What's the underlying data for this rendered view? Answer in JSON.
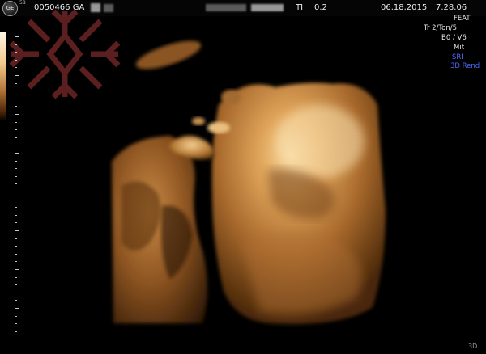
{
  "header": {
    "logo_text": "GE",
    "probe_index": "58",
    "patient_id": "0050466 GA",
    "ti_label": "TI",
    "ti_value": "0.2",
    "date": "06.18.2015",
    "time": "7.28.06"
  },
  "settings": [
    "FEAT",
    "Tr 2/Ton/5",
    "B0 / V6",
    "Mit",
    "SRI",
    "3D Rend"
  ],
  "footer": {
    "mode": "3D"
  }
}
